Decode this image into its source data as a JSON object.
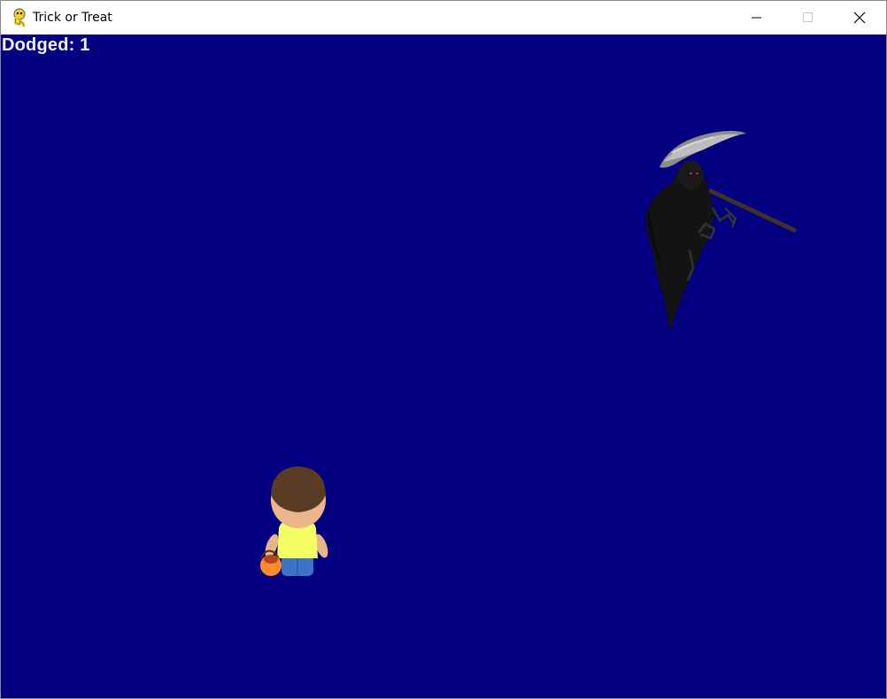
{
  "window": {
    "title": "Trick or Treat",
    "icon": "pygame-snake-icon",
    "controls": [
      "minimize-icon",
      "maximize-icon",
      "close-icon"
    ]
  },
  "game": {
    "background_color": "#020080",
    "score_text": "Dodged: 1",
    "sprites": [
      "grim-reaper-enemy",
      "trick-or-treater-player"
    ]
  }
}
